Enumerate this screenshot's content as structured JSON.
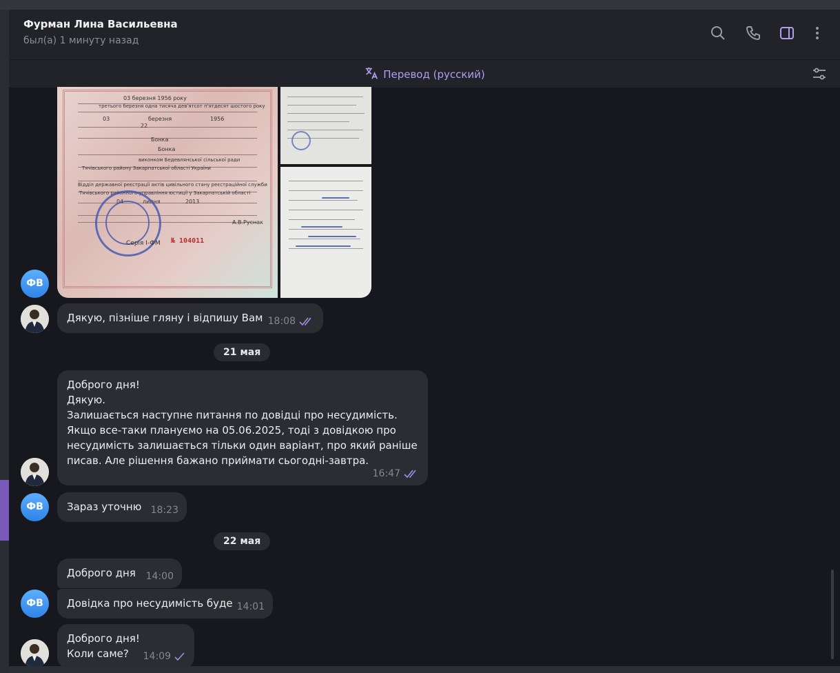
{
  "header": {
    "contact_name": "Фурман Лина Васильевна",
    "status": "был(а) 1 минуту назад",
    "icons": [
      "search-icon",
      "phone-icon",
      "sidebar-toggle-icon",
      "more-vertical-icon"
    ]
  },
  "translation_bar": {
    "label": "Перевод (русский)",
    "icon": "translate-icon",
    "settings_icon": "filter-settings-icon"
  },
  "colors": {
    "accent": "#b49cf2",
    "bubble": "#2b2d33",
    "chat_background": "#17181d",
    "avatar_fv": "#3f95f2"
  },
  "photo_document": {
    "lines": [
      "03 березня 1956 року",
      "третього березня одна тисяча дев'ятсот п'ятдесят шостого року",
      "03",
      "березня",
      "1956",
      "22",
      "Бонка",
      "Бонка",
      "виконком Бедевлянської сільської ради",
      "Тячівського району Закарпатської області України",
      "Відділ державної реєстрації актів цивільного стану реєстраційної служби",
      "Тячівського районного управління юстиції у Закарпатській області",
      "04",
      "липня",
      "2013",
      "А.В.Руснак",
      "Серія І-ФМ",
      "№ 104011"
    ]
  },
  "messages": [
    {
      "sender": "ФВ",
      "type": "photos"
    },
    {
      "sender": "me",
      "text": "Дякую, пізніше гляну і відпишу Вам",
      "time": "18:08",
      "status": "read"
    },
    {
      "date": "21 мая"
    },
    {
      "sender": "me",
      "text": "Доброго дня!\nДякую.\nЗалишається наступне питання по довідці про несудимість.\nЯкщо все-таки плануємо на 05.06.2025, тоді з довідкою про\nнесудимість залишається тільки один варіант, про який раніше\nписав. Але рішення бажано приймати сьогодні-завтра.",
      "time": "16:47",
      "status": "read"
    },
    {
      "sender": "ФВ",
      "text": "Зараз уточню",
      "time": "18:23"
    },
    {
      "date": "22 мая"
    },
    {
      "sender": "ФВ",
      "text": "Доброго дня",
      "time": "14:00"
    },
    {
      "sender": "ФВ",
      "text": "Довідка про несудимість буде",
      "time": "14:01"
    },
    {
      "sender": "me",
      "text": "Доброго дня!\nКоли саме?",
      "time": "14:09",
      "status": "sent"
    }
  ],
  "avatars": {
    "fv_initials": "ФВ"
  }
}
